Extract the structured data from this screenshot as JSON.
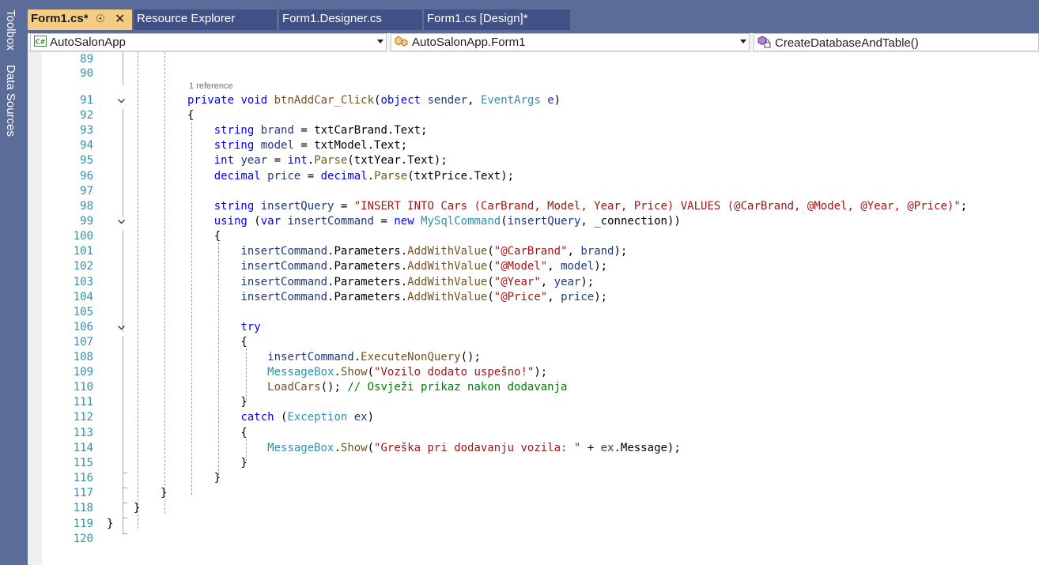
{
  "side_tabs": [
    "Toolbox",
    "Data Sources"
  ],
  "tabs": [
    {
      "label": "Form1.cs*",
      "pin": "☉",
      "close": "✕"
    },
    {
      "label": "Resource Explorer"
    },
    {
      "label": "Form1.Designer.cs"
    },
    {
      "label": "Form1.cs [Design]*"
    }
  ],
  "nav": {
    "project": "AutoSalonApp",
    "project_icon_text": "C#",
    "class": "AutoSalonApp.Form1",
    "member": "CreateDatabaseAndTable()"
  },
  "codelens": "1 reference",
  "code_lines": [
    {
      "n": "89",
      "tokens": []
    },
    {
      "n": "90",
      "tokens": []
    },
    {
      "n": "91",
      "tokens": [
        [
          "kw",
          "private"
        ],
        [
          "",
          ""
        ],
        [
          "kw",
          " void"
        ],
        [
          "",
          " "
        ],
        [
          "mt",
          "btnAddCar_Click"
        ],
        [
          "",
          "("
        ],
        [
          "kw",
          "object"
        ],
        [
          "",
          " "
        ],
        [
          "vr",
          "sender"
        ],
        [
          "",
          ", "
        ],
        [
          "ty",
          "EventArgs"
        ],
        [
          "",
          " "
        ],
        [
          "vr",
          "e"
        ],
        [
          "",
          ")"
        ]
      ]
    },
    {
      "n": "92",
      "tokens": [
        [
          "",
          "{"
        ]
      ]
    },
    {
      "n": "93",
      "tokens": [
        [
          "",
          "    "
        ],
        [
          "kw",
          "string"
        ],
        [
          "",
          " "
        ],
        [
          "vr",
          "brand"
        ],
        [
          "",
          " = "
        ],
        [
          "",
          "txtCarBrand.Text;"
        ]
      ]
    },
    {
      "n": "94",
      "tokens": [
        [
          "",
          "    "
        ],
        [
          "kw",
          "string"
        ],
        [
          "",
          " "
        ],
        [
          "vr",
          "model"
        ],
        [
          "",
          " = "
        ],
        [
          "",
          "txtModel.Text;"
        ]
      ]
    },
    {
      "n": "95",
      "tokens": [
        [
          "",
          "    "
        ],
        [
          "kw",
          "int"
        ],
        [
          "",
          " "
        ],
        [
          "vr",
          "year"
        ],
        [
          "",
          " = "
        ],
        [
          "kw",
          "int"
        ],
        [
          "",
          "."
        ],
        [
          "mt",
          "Parse"
        ],
        [
          "",
          "(txtYear.Text);"
        ]
      ]
    },
    {
      "n": "96",
      "tokens": [
        [
          "",
          "    "
        ],
        [
          "kw",
          "decimal"
        ],
        [
          "",
          " "
        ],
        [
          "vr",
          "price"
        ],
        [
          "",
          " = "
        ],
        [
          "kw",
          "decimal"
        ],
        [
          "",
          "."
        ],
        [
          "mt",
          "Parse"
        ],
        [
          "",
          "(txtPrice.Text);"
        ]
      ]
    },
    {
      "n": "97",
      "tokens": []
    },
    {
      "n": "98",
      "tokens": [
        [
          "",
          "    "
        ],
        [
          "kw",
          "string"
        ],
        [
          "",
          " "
        ],
        [
          "vr",
          "insertQuery"
        ],
        [
          "",
          " = "
        ],
        [
          "str",
          "\"INSERT INTO Cars (CarBrand, Model, Year, Price) VALUES (@CarBrand, @Model, @Year, @Price)\""
        ],
        [
          "",
          ";"
        ]
      ]
    },
    {
      "n": "99",
      "tokens": [
        [
          "",
          "    "
        ],
        [
          "kw",
          "using"
        ],
        [
          "",
          " ("
        ],
        [
          "kw",
          "var"
        ],
        [
          "",
          " "
        ],
        [
          "vr",
          "insertCommand"
        ],
        [
          "",
          " = "
        ],
        [
          "kw",
          "new"
        ],
        [
          "",
          " "
        ],
        [
          "ty",
          "MySqlCommand"
        ],
        [
          "",
          "("
        ],
        [
          "vr",
          "insertQuery"
        ],
        [
          "",
          ", _connection))"
        ]
      ]
    },
    {
      "n": "100",
      "tokens": [
        [
          "",
          "    {"
        ]
      ]
    },
    {
      "n": "101",
      "tokens": [
        [
          "",
          "        "
        ],
        [
          "vr",
          "insertCommand"
        ],
        [
          "",
          ".Parameters."
        ],
        [
          "mt",
          "AddWithValue"
        ],
        [
          "",
          "("
        ],
        [
          "str",
          "\"@CarBrand\""
        ],
        [
          "",
          ", "
        ],
        [
          "vr",
          "brand"
        ],
        [
          "",
          ");"
        ]
      ]
    },
    {
      "n": "102",
      "tokens": [
        [
          "",
          "        "
        ],
        [
          "vr",
          "insertCommand"
        ],
        [
          "",
          ".Parameters."
        ],
        [
          "mt",
          "AddWithValue"
        ],
        [
          "",
          "("
        ],
        [
          "str",
          "\"@Model\""
        ],
        [
          "",
          ", "
        ],
        [
          "vr",
          "model"
        ],
        [
          "",
          ");"
        ]
      ]
    },
    {
      "n": "103",
      "tokens": [
        [
          "",
          "        "
        ],
        [
          "vr",
          "insertCommand"
        ],
        [
          "",
          ".Parameters."
        ],
        [
          "mt",
          "AddWithValue"
        ],
        [
          "",
          "("
        ],
        [
          "str",
          "\"@Year\""
        ],
        [
          "",
          ", "
        ],
        [
          "vr",
          "year"
        ],
        [
          "",
          ");"
        ]
      ]
    },
    {
      "n": "104",
      "tokens": [
        [
          "",
          "        "
        ],
        [
          "vr",
          "insertCommand"
        ],
        [
          "",
          ".Parameters."
        ],
        [
          "mt",
          "AddWithValue"
        ],
        [
          "",
          "("
        ],
        [
          "str",
          "\"@Price\""
        ],
        [
          "",
          ", "
        ],
        [
          "vr",
          "price"
        ],
        [
          "",
          ");"
        ]
      ]
    },
    {
      "n": "105",
      "tokens": []
    },
    {
      "n": "106",
      "tokens": [
        [
          "",
          "        "
        ],
        [
          "kw",
          "try"
        ]
      ]
    },
    {
      "n": "107",
      "tokens": [
        [
          "",
          "        {"
        ]
      ]
    },
    {
      "n": "108",
      "tokens": [
        [
          "",
          "            "
        ],
        [
          "vr",
          "insertCommand"
        ],
        [
          "",
          "."
        ],
        [
          "mt",
          "ExecuteNonQuery"
        ],
        [
          "",
          "();"
        ]
      ]
    },
    {
      "n": "109",
      "tokens": [
        [
          "",
          "            "
        ],
        [
          "ty",
          "MessageBox"
        ],
        [
          "",
          "."
        ],
        [
          "mt",
          "Show"
        ],
        [
          "",
          "("
        ],
        [
          "str",
          "\"Vozilo dodato uspešno!\""
        ],
        [
          "",
          ");"
        ]
      ]
    },
    {
      "n": "110",
      "tokens": [
        [
          "",
          "            "
        ],
        [
          "mt",
          "LoadCars"
        ],
        [
          "",
          "(); "
        ],
        [
          "cm",
          "// Osvježi prikaz nakon dodavanja"
        ]
      ]
    },
    {
      "n": "111",
      "tokens": [
        [
          "",
          "        }"
        ]
      ]
    },
    {
      "n": "112",
      "tokens": [
        [
          "",
          "        "
        ],
        [
          "kw",
          "catch"
        ],
        [
          "",
          " ("
        ],
        [
          "ty",
          "Exception"
        ],
        [
          "",
          " "
        ],
        [
          "vr",
          "ex"
        ],
        [
          "",
          ")"
        ]
      ]
    },
    {
      "n": "113",
      "tokens": [
        [
          "",
          "        {"
        ]
      ]
    },
    {
      "n": "114",
      "tokens": [
        [
          "",
          "            "
        ],
        [
          "ty",
          "MessageBox"
        ],
        [
          "",
          "."
        ],
        [
          "mt",
          "Show"
        ],
        [
          "",
          "("
        ],
        [
          "str",
          "\"Greška pri dodavanju vozila: \""
        ],
        [
          "",
          " + "
        ],
        [
          "vr",
          "ex"
        ],
        [
          "",
          ".Message);"
        ]
      ]
    },
    {
      "n": "115",
      "tokens": [
        [
          "",
          "        }"
        ]
      ]
    },
    {
      "n": "116",
      "tokens": [
        [
          "",
          "    }"
        ]
      ]
    },
    {
      "n": "117",
      "tokens": [
        [
          "",
          "}"
        ]
      ]
    },
    {
      "n": "118",
      "tokens": [
        [
          "",
          "}"
        ]
      ]
    },
    {
      "n": "119",
      "tokens": [
        [
          "",
          "}"
        ]
      ]
    },
    {
      "n": "120",
      "tokens": []
    }
  ]
}
